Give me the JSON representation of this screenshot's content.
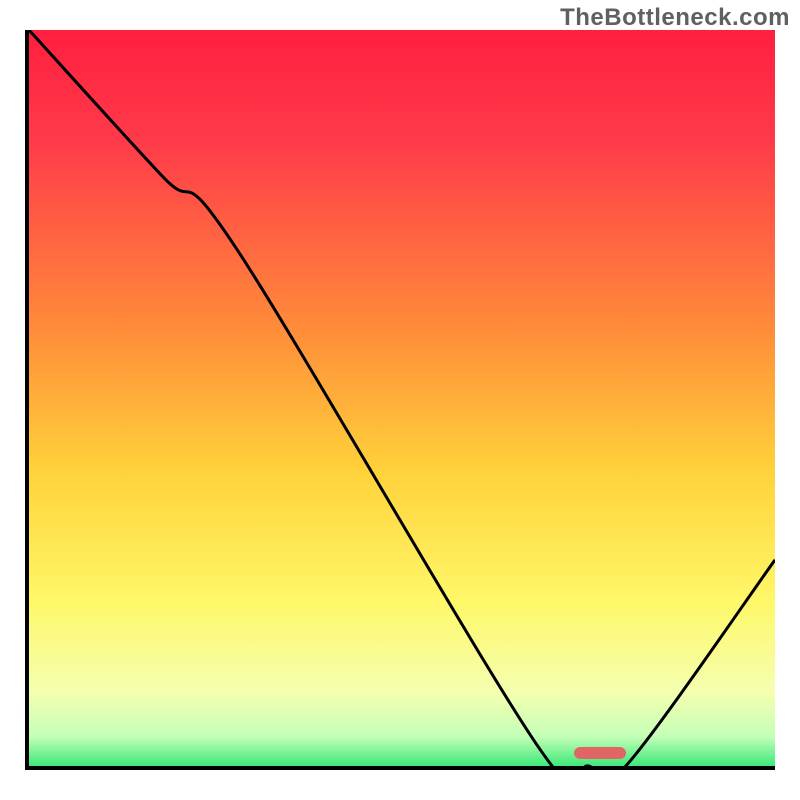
{
  "watermark": "TheBottleneck.com",
  "chart_data": {
    "type": "line",
    "title": "",
    "xlabel": "",
    "ylabel": "",
    "xlim": [
      0,
      100
    ],
    "ylim": [
      0,
      100
    ],
    "grid": false,
    "background": {
      "type": "vertical-gradient",
      "stops": [
        {
          "pct": 0,
          "color": "#ff1f3f"
        },
        {
          "pct": 15,
          "color": "#ff3a4a"
        },
        {
          "pct": 40,
          "color": "#ff8a3a"
        },
        {
          "pct": 60,
          "color": "#ffd23a"
        },
        {
          "pct": 78,
          "color": "#fff86a"
        },
        {
          "pct": 90,
          "color": "#f4ffb0"
        },
        {
          "pct": 96,
          "color": "#c4ffb8"
        },
        {
          "pct": 100,
          "color": "#3fe87a"
        }
      ]
    },
    "series": [
      {
        "name": "bottleneck-curve",
        "x": [
          0,
          18,
          28,
          68,
          75,
          80,
          100
        ],
        "y": [
          100,
          80,
          70,
          3,
          0,
          0,
          28
        ]
      }
    ],
    "marker": {
      "name": "optimal-range",
      "x_start": 73,
      "x_end": 80,
      "y": 1,
      "color": "#e06666"
    }
  }
}
